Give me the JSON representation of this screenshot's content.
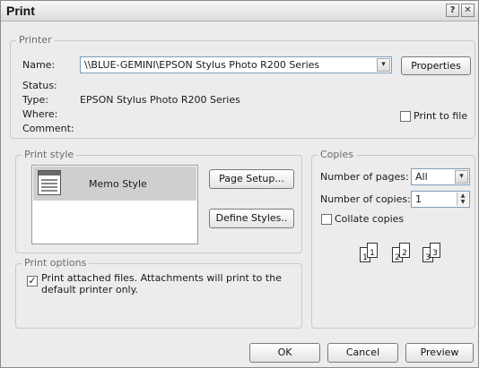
{
  "window": {
    "title": "Print",
    "help_glyph": "?",
    "close_glyph": "✕"
  },
  "printer": {
    "group_label": "Printer",
    "name_label": "Name:",
    "name_value": "\\\\BLUE-GEMINI\\EPSON Stylus Photo R200 Series",
    "properties_label": "Properties",
    "status_label": "Status:",
    "status_value": "",
    "type_label": "Type:",
    "type_value": "EPSON Stylus Photo R200 Series",
    "where_label": "Where:",
    "where_value": "",
    "comment_label": "Comment:",
    "comment_value": "",
    "print_to_file_label": "Print to file",
    "print_to_file_checked": false
  },
  "print_style": {
    "group_label": "Print style",
    "items": [
      {
        "label": "Memo Style",
        "selected": true
      }
    ],
    "page_setup_label": "Page Setup...",
    "define_styles_label": "Define Styles.."
  },
  "copies": {
    "group_label": "Copies",
    "num_pages_label": "Number of pages:",
    "num_pages_value": "All",
    "num_copies_label": "Number of copies:",
    "num_copies_value": "1",
    "collate_label": "Collate copies",
    "collate_checked": false,
    "collate_pages": [
      "1",
      "1",
      "2",
      "2",
      "3",
      "3"
    ]
  },
  "print_options": {
    "group_label": "Print options",
    "attach_label_line1": "Print attached files.  Attachments will print to the",
    "attach_label_line2": "default printer only.",
    "attach_checked": true
  },
  "footer": {
    "ok_label": "OK",
    "cancel_label": "Cancel",
    "preview_label": "Preview"
  },
  "icons": {
    "check": "✓",
    "dropdown": "▾",
    "spin_up": "▲",
    "spin_down": "▼"
  }
}
